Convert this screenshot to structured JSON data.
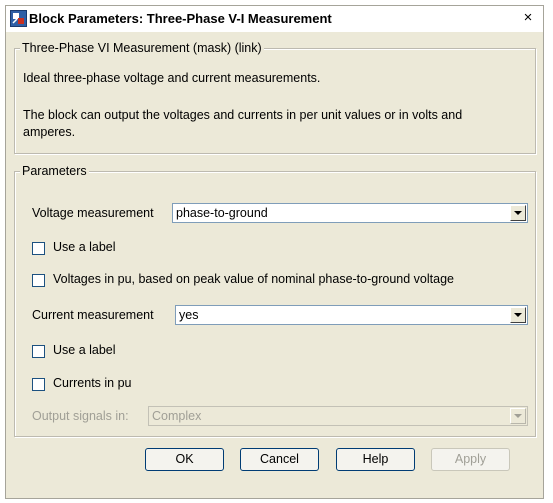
{
  "window": {
    "title": "Block Parameters: Three-Phase V-I Measurement",
    "close_symbol": "×",
    "app_icon": "simulink-block-icon"
  },
  "description": {
    "group_title": "Three-Phase VI Measurement (mask) (link)",
    "line1": "Ideal three-phase voltage and current measurements.",
    "line2": "The block can output the voltages and currents in per unit values or in volts and",
    "line3": "amperes."
  },
  "parameters": {
    "group_title": "Parameters",
    "voltage_measurement": {
      "label": "Voltage measurement",
      "value": "phase-to-ground"
    },
    "voltage_use_label": {
      "label": "Use a label",
      "checked": false
    },
    "voltages_in_pu": {
      "label": "Voltages in pu,  based on peak value of nominal phase-to-ground voltage",
      "checked": false
    },
    "current_measurement": {
      "label": "Current measurement",
      "value": "yes"
    },
    "current_use_label": {
      "label": "Use a label",
      "checked": false
    },
    "currents_in_pu": {
      "label": "Currents in pu",
      "checked": false
    },
    "output_signals": {
      "label": "Output signals in:",
      "value": "Complex",
      "enabled": false
    }
  },
  "buttons": {
    "ok": "OK",
    "cancel": "Cancel",
    "help": "Help",
    "apply": "Apply"
  },
  "colors": {
    "dialog_bg": "#ece9d8",
    "disabled_text": "#a09f96",
    "input_border": "#7f9db9"
  }
}
